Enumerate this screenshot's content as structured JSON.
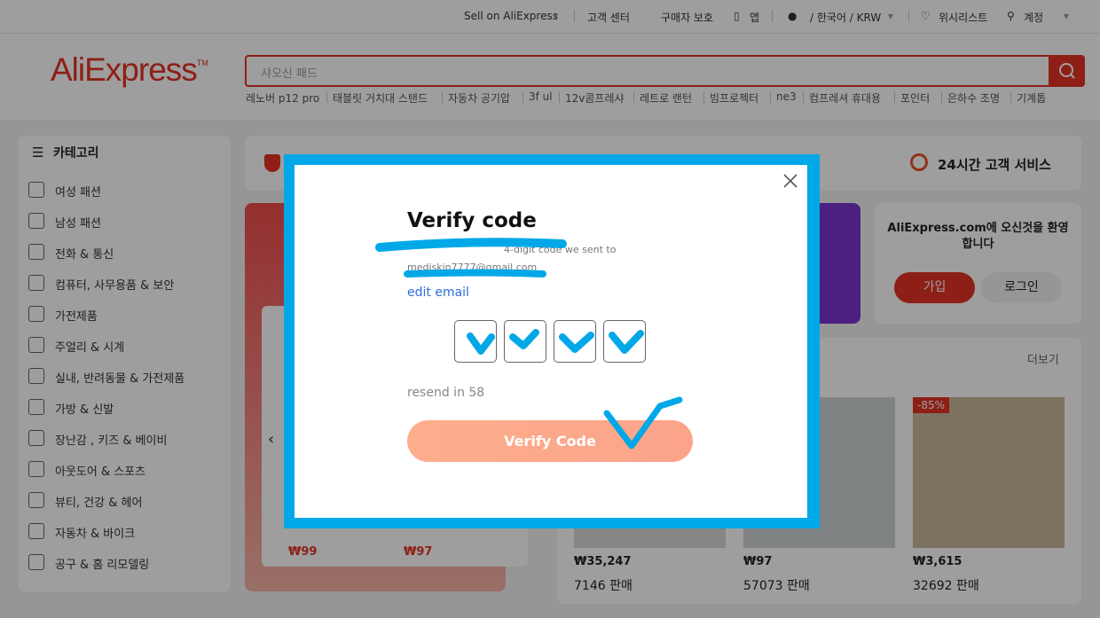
{
  "topbar": {
    "sell": "Sell on AliExpress",
    "support": "고객 센터",
    "protection": "구매자 보호",
    "app": "앱",
    "locale": "/ 한국어 / KRW",
    "wishlist": "위시리스트",
    "account": "계정"
  },
  "header": {
    "logo": "AliExpress",
    "search_placeholder": "샤오신 패드",
    "hot_searches": [
      "레노버 p12 pro",
      "태블릿 거치대 스탠드",
      "자동차 공기압",
      "3f ul",
      "12v콤프레샤",
      "레트로 랜턴",
      "빔프로젝터",
      "ne3",
      "컴프레셔 휴대용",
      "포인터",
      "은하수 조명",
      "기계톱"
    ]
  },
  "sidebar": {
    "title": "카테고리",
    "items": [
      "여성 패션",
      "남성 패션",
      "전화 & 통신",
      "컴퓨터, 사무용품 & 보안",
      "가전제품",
      "주얼리 & 시계",
      "실내, 반려동물 & 가전제품",
      "가방 & 신발",
      "장난감 , 키즈 & 베이비",
      "아웃도어 & 스포츠",
      "뷰티, 건강 & 헤어",
      "자동차 & 바이크",
      "공구 & 홈 리모델링"
    ]
  },
  "service": {
    "label": "24시간 고객 서비스"
  },
  "welcome": {
    "text": "AliExpress.com에 오신것을 환영합니다",
    "join": "가입",
    "login": "로그인"
  },
  "products": {
    "more": "더보기",
    "left_prices": [
      "₩99",
      "₩97"
    ],
    "items": [
      {
        "price": "₩35,247",
        "sold": "7146 판매"
      },
      {
        "price": "₩97",
        "sold": "57073 판매"
      },
      {
        "price": "₩3,615",
        "sold": "32692 판매",
        "discount": "-85%"
      }
    ]
  },
  "modal": {
    "title": "Verify code",
    "desc": "4-digit code we sent to",
    "email": "mediskin7777@gmail.com",
    "edit_email": "edit email",
    "resend": "resend in 58",
    "verify_button": "Verify Code"
  },
  "colors": {
    "brand": "#e43225",
    "annotation": "#00a8e8"
  }
}
